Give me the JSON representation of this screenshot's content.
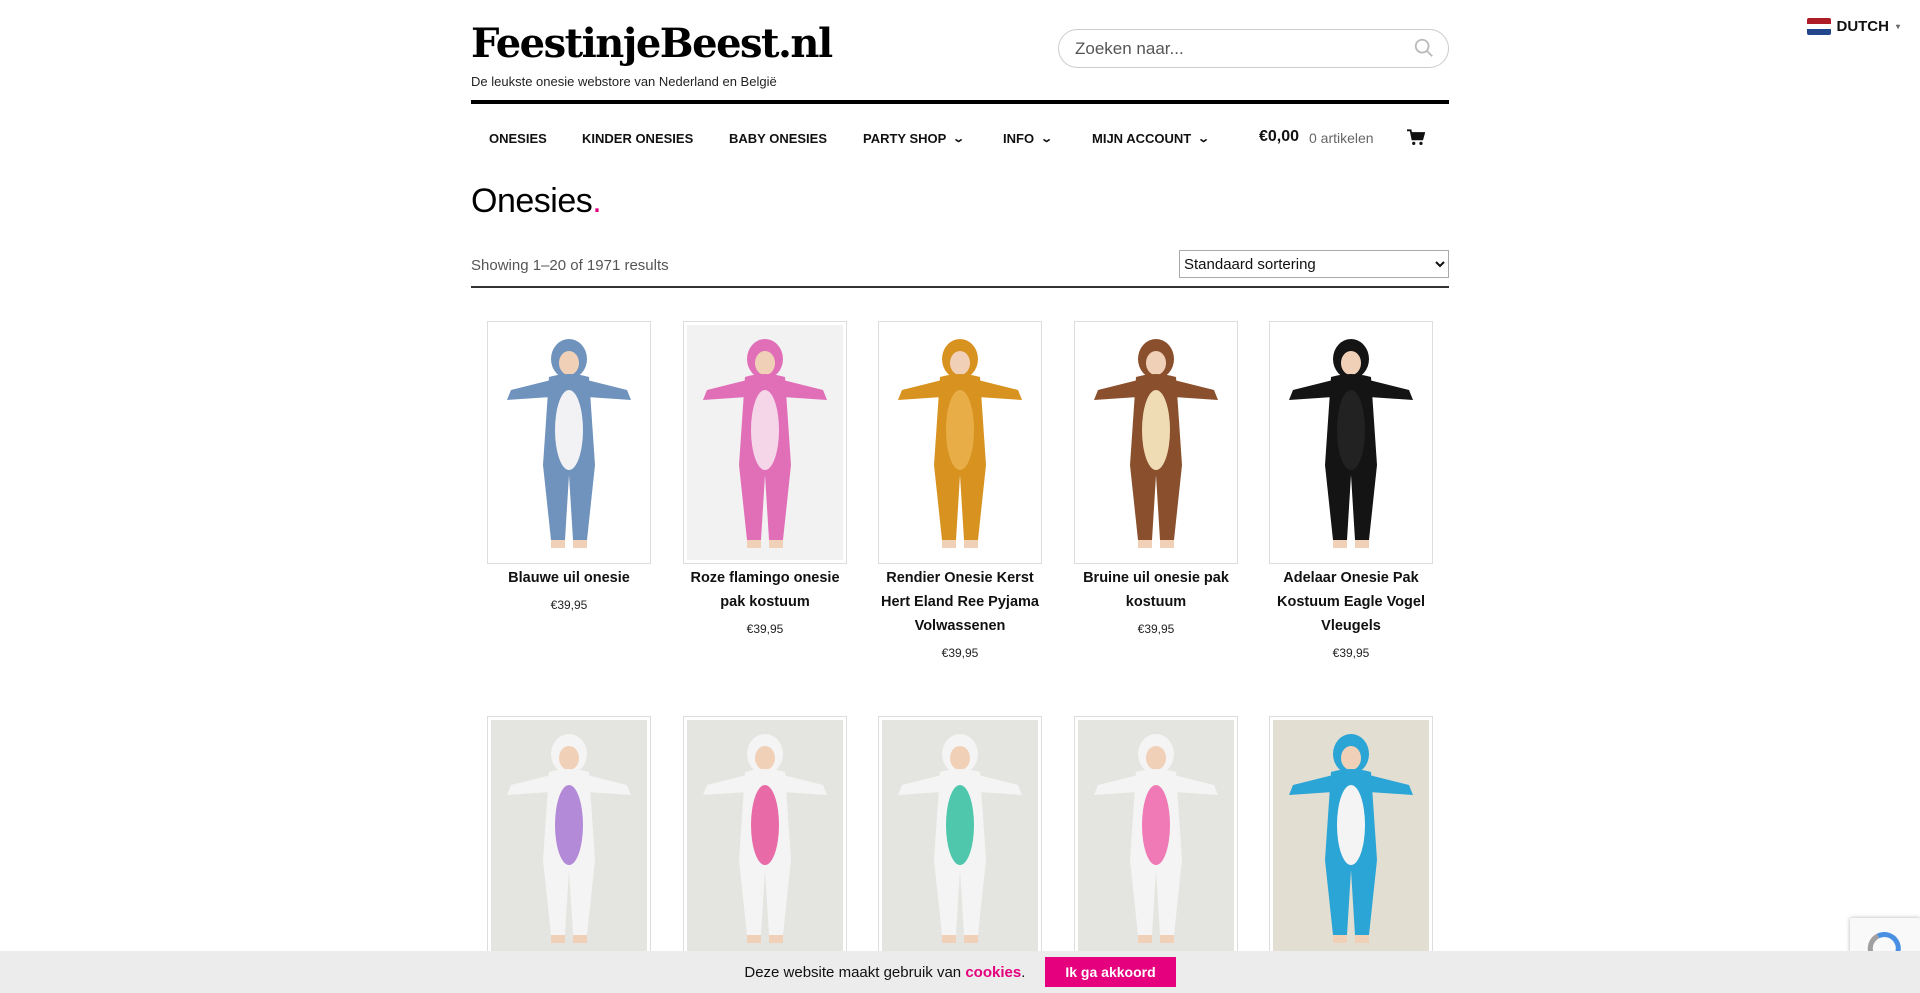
{
  "language": {
    "label": "DUTCH",
    "caret": "▾",
    "flag_colors": [
      "#ae1c28",
      "#ffffff",
      "#21468b"
    ]
  },
  "header": {
    "site_title": "FeestinjeBeest.nl",
    "tagline": "De leukste onesie webstore van Nederland en België",
    "search_placeholder": "Zoeken naar..."
  },
  "nav": {
    "items": [
      {
        "label": "ONESIES",
        "has_dropdown": false
      },
      {
        "label": "KINDER ONESIES",
        "has_dropdown": false
      },
      {
        "label": "BABY ONESIES",
        "has_dropdown": false
      },
      {
        "label": "PARTY SHOP",
        "has_dropdown": true
      },
      {
        "label": "INFO",
        "has_dropdown": true
      },
      {
        "label": "MIJN ACCOUNT",
        "has_dropdown": true
      }
    ],
    "chevron": "⌄",
    "cart_total": "€0,00",
    "cart_count": "0 artikelen"
  },
  "page": {
    "title": "Onesies",
    "title_dot": "."
  },
  "toolbar": {
    "results": "Showing 1–20 of 1971 results",
    "sort_selected": "Standaard sortering"
  },
  "products": [
    {
      "name": "Blauwe uil onesie",
      "price": "€39,95",
      "body_color": "#6f93bd",
      "belly_color": "#f2f2f5",
      "bg": "#ffffff"
    },
    {
      "name": "Roze flamingo onesie pak kostuum",
      "price": "€39,95",
      "body_color": "#e06fb8",
      "belly_color": "#f5d6e8",
      "bg": "#f2f2f2"
    },
    {
      "name": "Rendier Onesie Kerst Hert Eland Ree Pyjama Volwassenen",
      "price": "€39,95",
      "body_color": "#d8921f",
      "belly_color": "#e9ad48",
      "bg": "#ffffff"
    },
    {
      "name": "Bruine uil onesie pak kostuum",
      "price": "€39,95",
      "body_color": "#8a4f2c",
      "belly_color": "#f0dcb4",
      "bg": "#ffffff"
    },
    {
      "name": "Adelaar Onesie Pak Kostuum Eagle Vogel Vleugels",
      "price": "€39,95",
      "body_color": "#141414",
      "belly_color": "#222222",
      "bg": "#ffffff"
    },
    {
      "name": "",
      "price": "",
      "body_color": "#f4f4f4",
      "belly_color": "#b38ad8",
      "bg": "#e4e4e0"
    },
    {
      "name": "",
      "price": "",
      "body_color": "#f4f4f4",
      "belly_color": "#e86aa7",
      "bg": "#e4e4e0"
    },
    {
      "name": "",
      "price": "",
      "body_color": "#f4f4f4",
      "belly_color": "#4ec7ad",
      "bg": "#e4e4e0"
    },
    {
      "name": "",
      "price": "",
      "body_color": "#f4f4f4",
      "belly_color": "#f07ab5",
      "bg": "#e4e4e0"
    },
    {
      "name": "",
      "price": "",
      "body_color": "#2aa5d6",
      "belly_color": "#f4f4f4",
      "bg": "#e2ded2"
    }
  ],
  "cookie": {
    "text": "Deze website maakt gebruik van",
    "link": "cookies",
    "period": ".",
    "button": "Ik ga akkoord"
  },
  "colors": {
    "accent": "#e5007e"
  }
}
